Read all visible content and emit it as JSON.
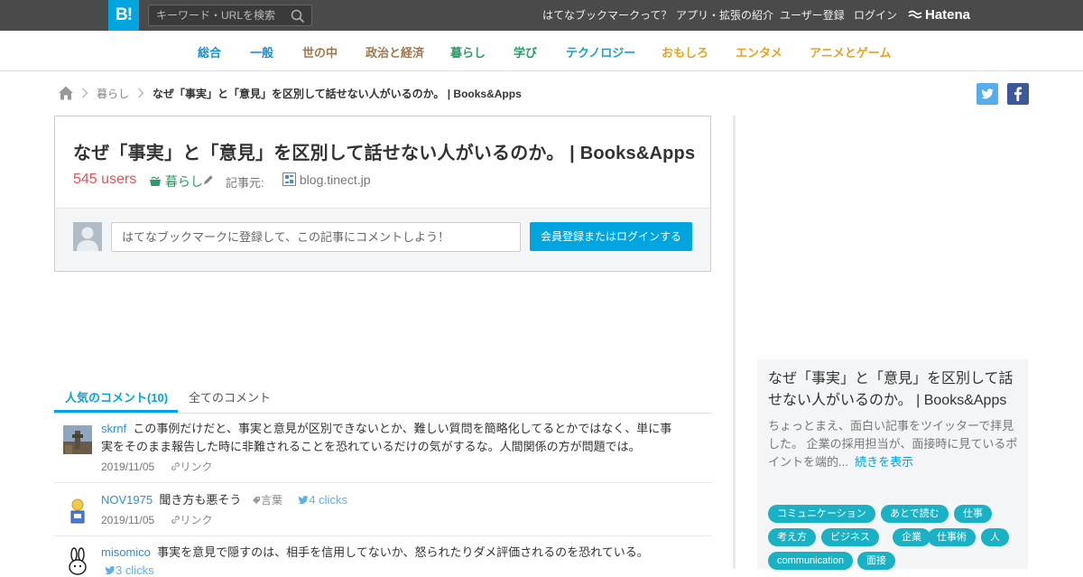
{
  "header": {
    "logo": "B!",
    "search_placeholder": "キーワード・URLを検索",
    "nav": [
      "はてなブックマークって？",
      "アプリ・拡張の紹介",
      "ユーザー登録",
      "ログイン"
    ],
    "brand": "Hatena"
  },
  "categories": [
    {
      "label": "総合",
      "color": "#1a8fd0"
    },
    {
      "label": "一般",
      "color": "#1a8fd0"
    },
    {
      "label": "世の中",
      "color": "#a0784c"
    },
    {
      "label": "政治と経済",
      "color": "#a0784c"
    },
    {
      "label": "暮らし",
      "color": "#2d9a6a"
    },
    {
      "label": "学び",
      "color": "#2d9a6a"
    },
    {
      "label": "テクノロジー",
      "color": "#1aa0c8"
    },
    {
      "label": "おもしろ",
      "color": "#e8a21d"
    },
    {
      "label": "エンタメ",
      "color": "#e8a21d"
    },
    {
      "label": "アニメとゲーム",
      "color": "#e8a21d"
    }
  ],
  "breadcrumb": {
    "category": "暮らし",
    "current": "なぜ「事実」と「意見」を区別して話せない人がいるのか。 | Books&Apps"
  },
  "entry": {
    "title": "なぜ「事実」と「意見」を区別して話せない人がいるのか。 | Books&Apps",
    "users": "545 users",
    "category": "暮らし",
    "source_label": "記事元:",
    "source": "blog.tinect.jp",
    "comment_placeholder": "はてなブックマークに登録して、この記事にコメントしよう！",
    "login_button": "会員登録またはログインする"
  },
  "tabs": {
    "popular": "人気のコメント(10)",
    "all": "全てのコメント"
  },
  "comments": [
    {
      "user": "skrnf",
      "text_line1": "この事例だけだと、事実と意見が区別できないとか、難しい質問を簡略化してるとかではなく、単に事",
      "text_line2": "実をそのまま報告した時に非難されることを恐れているだけの気がするな。人間関係の方が問題では。",
      "date": "2019/11/05",
      "link": "リンク"
    },
    {
      "user": "NOV1975",
      "text": "聞き方も悪そう",
      "tag": "言葉",
      "clicks": "4 clicks",
      "date": "2019/11/05",
      "link": "リンク"
    },
    {
      "user": "misomico",
      "text": "事実を意見で隠すのは、相手を信用してないか、怒られたりダメ評価されるのを恐れている。",
      "clicks": "3 clicks"
    }
  ],
  "sidebar": {
    "title": "なぜ「事実」と「意見」を区別して話せない人がいるのか。 | Books&Apps",
    "desc_a": "ちょっとまえ、面白い記事をツイッターで拝見した。 企業の採用担当が、面接時に見ているポイントを端的...",
    "more": "続きを表示",
    "tags": [
      "コミュニケーション",
      "あとで読む",
      "仕事",
      "考え方",
      "ビジネス",
      "企業",
      "仕事術",
      "人",
      "communication",
      "面接"
    ]
  },
  "colors": {
    "accent": "#00a4de",
    "users": "#e0555a",
    "tag_bg": "#1ab1c4",
    "topbar": "#4a4a4a"
  }
}
